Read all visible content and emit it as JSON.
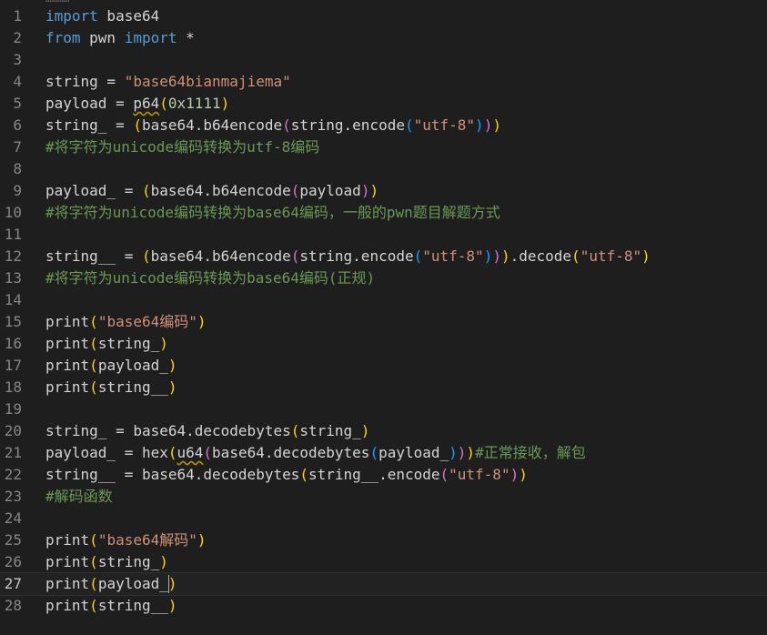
{
  "editor": {
    "top_fragment": "…………",
    "current_line": 27,
    "colors": {
      "background": "#1e1e1e",
      "keyword": "#569cd6",
      "string": "#ce9178",
      "number": "#b5cea8",
      "comment": "#6a9955",
      "bracket_1": "#ffd700",
      "bracket_2": "#da70d6",
      "bracket_3": "#179fff"
    },
    "lines": [
      {
        "n": "1",
        "tokens": [
          [
            "kw",
            "import"
          ],
          [
            "plain",
            " base64"
          ]
        ]
      },
      {
        "n": "2",
        "tokens": [
          [
            "kw",
            "from"
          ],
          [
            "plain",
            " pwn "
          ],
          [
            "kw",
            "import"
          ],
          [
            "plain",
            " *"
          ]
        ]
      },
      {
        "n": "3",
        "tokens": []
      },
      {
        "n": "4",
        "tokens": [
          [
            "plain",
            "string = "
          ],
          [
            "str",
            "\"base64bianmajiema\""
          ]
        ]
      },
      {
        "n": "5",
        "tokens": [
          [
            "plain",
            "payload = "
          ],
          [
            "warn",
            "p64"
          ],
          [
            "p1",
            "("
          ],
          [
            "num",
            "0x1111"
          ],
          [
            "p1",
            ")"
          ]
        ]
      },
      {
        "n": "6",
        "tokens": [
          [
            "plain",
            "string_ = "
          ],
          [
            "p1",
            "("
          ],
          [
            "plain",
            "base64.b64encode"
          ],
          [
            "p2",
            "("
          ],
          [
            "plain",
            "string.encode"
          ],
          [
            "p3",
            "("
          ],
          [
            "str",
            "\"utf-8\""
          ],
          [
            "p3",
            ")"
          ],
          [
            "p2",
            ")"
          ],
          [
            "p1",
            ")"
          ]
        ]
      },
      {
        "n": "7",
        "tokens": [
          [
            "cm",
            "#将字符为unicode编码转换为utf-8编码"
          ]
        ]
      },
      {
        "n": "8",
        "tokens": []
      },
      {
        "n": "9",
        "tokens": [
          [
            "plain",
            "payload_ = "
          ],
          [
            "p1",
            "("
          ],
          [
            "plain",
            "base64.b64encode"
          ],
          [
            "p2",
            "("
          ],
          [
            "plain",
            "payload"
          ],
          [
            "p2",
            ")"
          ],
          [
            "p1",
            ")"
          ]
        ]
      },
      {
        "n": "10",
        "tokens": [
          [
            "cm",
            "#将字符为unicode编码转换为base64编码，一般的pwn题目解题方式"
          ]
        ]
      },
      {
        "n": "11",
        "tokens": []
      },
      {
        "n": "12",
        "tokens": [
          [
            "plain",
            "string__ = "
          ],
          [
            "p1",
            "("
          ],
          [
            "plain",
            "base64.b64encode"
          ],
          [
            "p2",
            "("
          ],
          [
            "plain",
            "string.encode"
          ],
          [
            "p3",
            "("
          ],
          [
            "str",
            "\"utf-8\""
          ],
          [
            "p3",
            ")"
          ],
          [
            "p2",
            ")"
          ],
          [
            "p1",
            ")"
          ],
          [
            "plain",
            ".decode"
          ],
          [
            "p1",
            "("
          ],
          [
            "str",
            "\"utf-8\""
          ],
          [
            "p1",
            ")"
          ]
        ]
      },
      {
        "n": "13",
        "tokens": [
          [
            "cm",
            "#将字符为unicode编码转换为base64编码(正规)"
          ]
        ]
      },
      {
        "n": "14",
        "tokens": []
      },
      {
        "n": "15",
        "tokens": [
          [
            "plain",
            "print"
          ],
          [
            "p1",
            "("
          ],
          [
            "str",
            "\"base64编码\""
          ],
          [
            "p1",
            ")"
          ]
        ]
      },
      {
        "n": "16",
        "tokens": [
          [
            "plain",
            "print"
          ],
          [
            "p1",
            "("
          ],
          [
            "plain",
            "string_"
          ],
          [
            "p1",
            ")"
          ]
        ]
      },
      {
        "n": "17",
        "tokens": [
          [
            "plain",
            "print"
          ],
          [
            "p1",
            "("
          ],
          [
            "plain",
            "payload_"
          ],
          [
            "p1",
            ")"
          ]
        ]
      },
      {
        "n": "18",
        "tokens": [
          [
            "plain",
            "print"
          ],
          [
            "p1",
            "("
          ],
          [
            "plain",
            "string__"
          ],
          [
            "p1",
            ")"
          ]
        ]
      },
      {
        "n": "19",
        "tokens": []
      },
      {
        "n": "20",
        "tokens": [
          [
            "plain",
            "string_ = base64.decodebytes"
          ],
          [
            "p1",
            "("
          ],
          [
            "plain",
            "string_"
          ],
          [
            "p1",
            ")"
          ]
        ]
      },
      {
        "n": "21",
        "tokens": [
          [
            "plain",
            "payload_ = hex"
          ],
          [
            "p1",
            "("
          ],
          [
            "warn",
            "u64"
          ],
          [
            "p2",
            "("
          ],
          [
            "plain",
            "base64.decodebytes"
          ],
          [
            "p3",
            "("
          ],
          [
            "plain",
            "payload_"
          ],
          [
            "p3",
            ")"
          ],
          [
            "p2",
            ")"
          ],
          [
            "p1",
            ")"
          ],
          [
            "cm",
            "#正常接收，解包"
          ]
        ]
      },
      {
        "n": "22",
        "tokens": [
          [
            "plain",
            "string__ = base64.decodebytes"
          ],
          [
            "p1",
            "("
          ],
          [
            "plain",
            "string__.encode"
          ],
          [
            "p2",
            "("
          ],
          [
            "str",
            "\"utf-8\""
          ],
          [
            "p2",
            ")"
          ],
          [
            "p1",
            ")"
          ]
        ]
      },
      {
        "n": "23",
        "tokens": [
          [
            "cm",
            "#解码函数"
          ]
        ]
      },
      {
        "n": "24",
        "tokens": []
      },
      {
        "n": "25",
        "tokens": [
          [
            "plain",
            "print"
          ],
          [
            "p1",
            "("
          ],
          [
            "str",
            "\"base64解码\""
          ],
          [
            "p1",
            ")"
          ]
        ]
      },
      {
        "n": "26",
        "tokens": [
          [
            "plain",
            "print"
          ],
          [
            "p1",
            "("
          ],
          [
            "plain",
            "string_"
          ],
          [
            "p1",
            ")"
          ]
        ]
      },
      {
        "n": "27",
        "tokens": [
          [
            "plain",
            "print"
          ],
          [
            "p1",
            "("
          ],
          [
            "plain",
            "payload_"
          ],
          [
            "p1",
            ")"
          ]
        ]
      },
      {
        "n": "28",
        "tokens": [
          [
            "plain",
            "print"
          ],
          [
            "p1",
            "("
          ],
          [
            "plain",
            "string__"
          ],
          [
            "p1",
            ")"
          ]
        ]
      }
    ]
  }
}
